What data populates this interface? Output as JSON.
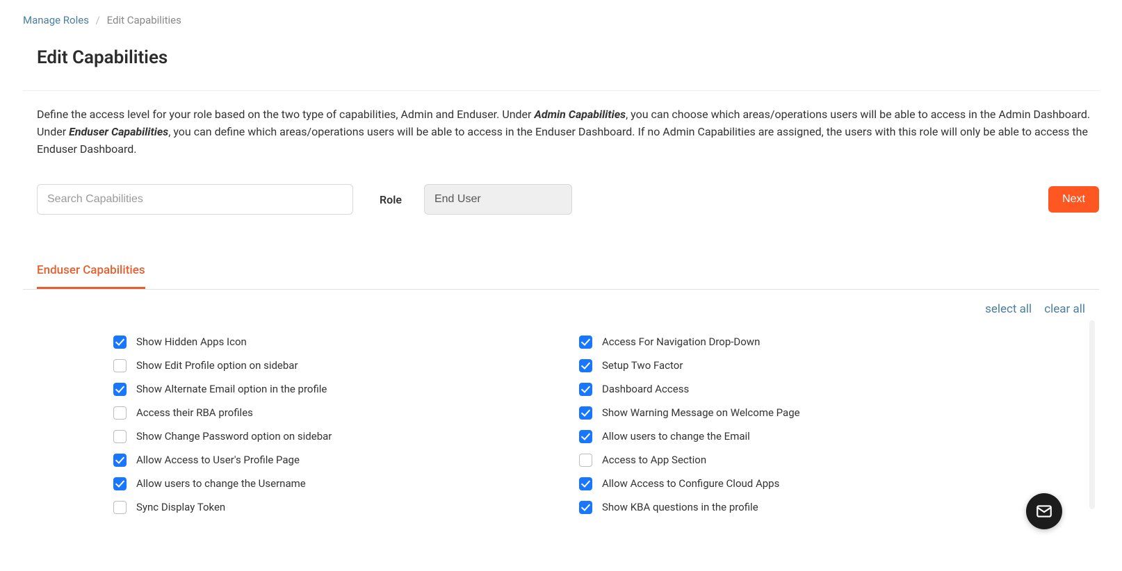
{
  "breadcrumb": {
    "parent": "Manage Roles",
    "current": "Edit Capabilities"
  },
  "page_title": "Edit Capabilities",
  "description": {
    "part1": "Define the access level for your role based on the two type of capabilities, Admin and Enduser. Under ",
    "bold1": "Admin Capabilities",
    "part2": ", you can choose which areas/operations users will be able to access in the Admin Dashboard. Under ",
    "bold2": "Enduser Capabilities",
    "part3": ", you can define which areas/operations users will be able to access in the Enduser Dashboard. If no Admin Capabilities are assigned, the users with this role will only be able to access the Enduser Dashboard."
  },
  "search": {
    "placeholder": "Search Capabilities"
  },
  "role": {
    "label": "Role",
    "value": "End User"
  },
  "buttons": {
    "next": "Next"
  },
  "tabs": {
    "active": "Enduser Capabilities"
  },
  "actions": {
    "select_all": "select all",
    "clear_all": "clear all"
  },
  "capabilities": {
    "left": [
      {
        "label": "Show Hidden Apps Icon",
        "checked": true
      },
      {
        "label": "Show Edit Profile option on sidebar",
        "checked": false
      },
      {
        "label": "Show Alternate Email option in the profile",
        "checked": true
      },
      {
        "label": "Access their RBA profiles",
        "checked": false
      },
      {
        "label": "Show Change Password option on sidebar",
        "checked": false
      },
      {
        "label": "Allow Access to User's Profile Page",
        "checked": true
      },
      {
        "label": "Allow users to change the Username",
        "checked": true
      },
      {
        "label": "Sync Display Token",
        "checked": false
      }
    ],
    "right": [
      {
        "label": "Access For Navigation Drop-Down",
        "checked": true
      },
      {
        "label": "Setup Two Factor",
        "checked": true
      },
      {
        "label": "Dashboard Access",
        "checked": true
      },
      {
        "label": "Show Warning Message on Welcome Page",
        "checked": true
      },
      {
        "label": "Allow users to change the Email",
        "checked": true
      },
      {
        "label": "Access to App Section",
        "checked": false
      },
      {
        "label": "Allow Access to Configure Cloud Apps",
        "checked": true
      },
      {
        "label": "Show KBA questions in the profile",
        "checked": true
      }
    ]
  }
}
